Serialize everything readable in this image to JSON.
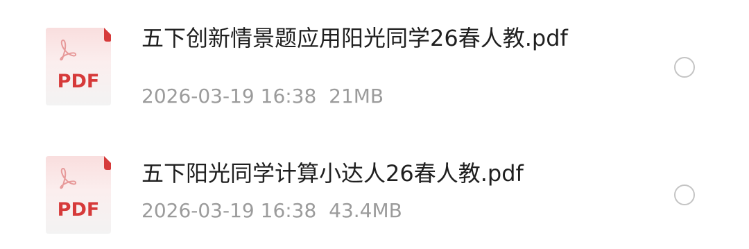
{
  "files": [
    {
      "icon": "pdf-file-icon",
      "icon_label": "PDF",
      "name": "五下创新情景题应用阳光同学26春人教.pdf",
      "date": "2026-03-19 16:38",
      "size": "21MB",
      "selected": false
    },
    {
      "icon": "pdf-file-icon",
      "icon_label": "PDF",
      "name": "五下阳光同学计算小达人26春人教.pdf",
      "date": "2026-03-19 16:38",
      "size": "43.4MB",
      "selected": false
    }
  ],
  "colors": {
    "pdf_red": "#d63a3a",
    "name_text": "#1f1f1f",
    "meta_text": "#9b9b9b",
    "radio_border": "#c4c4c4"
  }
}
